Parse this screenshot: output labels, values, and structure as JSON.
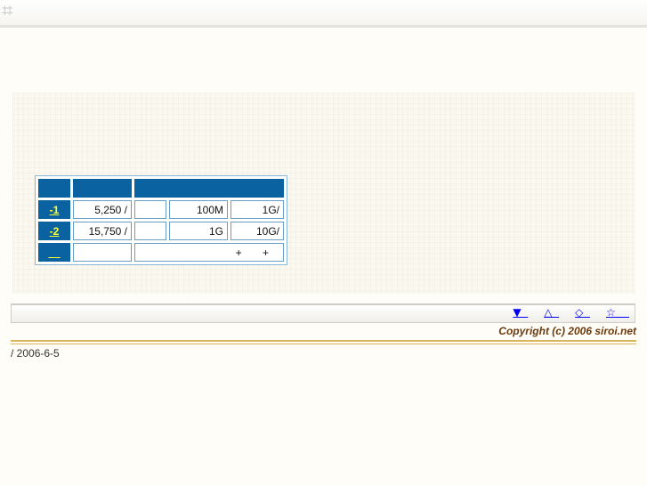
{
  "header": {
    "logo_glyph": "⌗"
  },
  "panel": {
    "link_text": "    "
  },
  "table": {
    "header_cells": [
      "",
      "",
      ""
    ],
    "rows": [
      {
        "plan": "-1",
        "price": "5,250 /",
        "blank": "",
        "capacity": "100M",
        "transfer": "1G/"
      },
      {
        "plan": "-2",
        "price": "15,750 /",
        "blank": "",
        "capacity": "1G",
        "transfer": "10G/"
      }
    ],
    "footer": {
      "link": "    ",
      "blank": "",
      "note": "+       +"
    }
  },
  "nav": {
    "links": [
      "▼  ",
      "△  ",
      "◇  ",
      "☆    "
    ]
  },
  "copyright": "Copyright (c) 2006 siroi.net",
  "date_line": "/ 2006-6-5",
  "colors": {
    "table_header": "#0a63a0",
    "plan_link": "#ffff33",
    "copyright": "#6b3a0e",
    "rule": "#d9b45a"
  }
}
